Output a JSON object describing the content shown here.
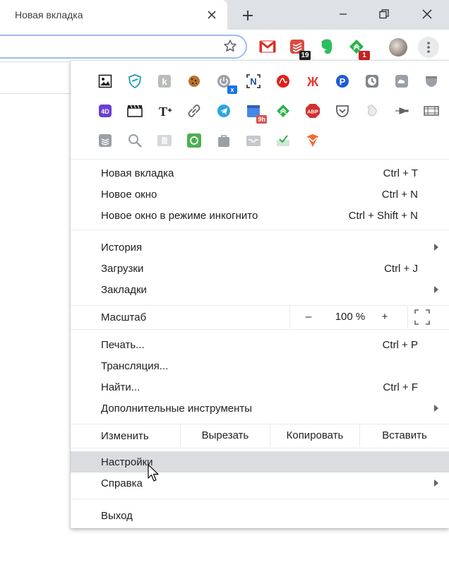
{
  "tab": {
    "title": "Новая вкладка"
  },
  "toolbar": {
    "extensions": [
      {
        "icon": "gmail-icon",
        "badge": ""
      },
      {
        "icon": "todoist-icon",
        "badge": "19"
      },
      {
        "icon": "evernote-icon",
        "badge": ""
      },
      {
        "icon": "feedly-icon",
        "badge": "1"
      }
    ]
  },
  "extensions_menu": {
    "rows": [
      [
        "image-icon",
        "shield-icon",
        "k-icon",
        "cookie-icon",
        "power-icon",
        "n-icon",
        "adobe-icon",
        "zh-icon",
        "p-icon",
        "clock-icon",
        "cloud-icon",
        "pocket-gray-icon"
      ],
      [
        "4d-icon",
        "clapper-icon",
        "text-icon",
        "link-icon",
        "telegram-icon",
        "calendar-icon",
        "feedly-icon",
        "abp-icon",
        "pocket-icon",
        "mouse-icon",
        "pin-icon",
        "film-icon"
      ],
      [
        "stack-icon",
        "zoom-icon",
        "doc-icon",
        "recycle-icon",
        "bag-icon",
        "tray-icon",
        "inbox-check-icon",
        "todoist-icon"
      ]
    ],
    "badges": {
      "power": "x",
      "calendar": "9h"
    }
  },
  "menu": {
    "new_tab": {
      "label": "Новая вкладка",
      "shortcut": "Ctrl + T"
    },
    "new_window": {
      "label": "Новое окно",
      "shortcut": "Ctrl + N"
    },
    "incognito": {
      "label": "Новое окно в режиме инкогнито",
      "shortcut": "Ctrl + Shift + N"
    },
    "history": {
      "label": "История"
    },
    "downloads": {
      "label": "Загрузки",
      "shortcut": "Ctrl + J"
    },
    "bookmarks": {
      "label": "Закладки"
    },
    "zoom": {
      "label": "Масштаб",
      "minus": "–",
      "value": "100 %",
      "plus": "+"
    },
    "print": {
      "label": "Печать...",
      "shortcut": "Ctrl + P"
    },
    "cast": {
      "label": "Трансляция..."
    },
    "find": {
      "label": "Найти...",
      "shortcut": "Ctrl + F"
    },
    "more_tools": {
      "label": "Дополнительные инструменты"
    },
    "edit": {
      "label": "Изменить",
      "cut": "Вырезать",
      "copy": "Копировать",
      "paste": "Вставить"
    },
    "settings": {
      "label": "Настройки"
    },
    "help": {
      "label": "Справка"
    },
    "exit": {
      "label": "Выход"
    }
  },
  "colors": {
    "menu_hover": "#dadce0",
    "titlebar": "#dee1e6",
    "omnibox_focus": "#9bbcf7"
  }
}
